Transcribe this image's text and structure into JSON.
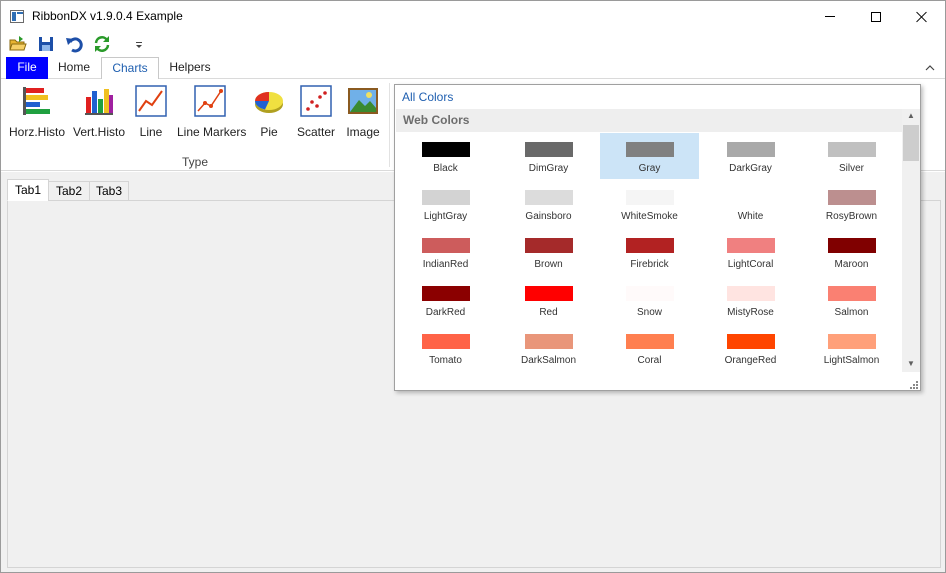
{
  "window": {
    "title": "RibbonDX v1.9.0.4 Example"
  },
  "quick_access": {
    "icons": [
      "open-folder-icon",
      "save-icon",
      "undo-icon",
      "refresh-icon",
      "customize-dropdown-icon"
    ]
  },
  "ribbon_tabs": [
    {
      "label": "File"
    },
    {
      "label": "Home"
    },
    {
      "label": "Charts"
    },
    {
      "label": "Helpers"
    }
  ],
  "chart_buttons": [
    {
      "label": "Horz.Histo",
      "icon": "horizontal-histogram-icon"
    },
    {
      "label": "Vert.Histo",
      "icon": "vertical-histogram-icon"
    },
    {
      "label": "Line",
      "icon": "line-chart-icon"
    },
    {
      "label": "Line Markers",
      "icon": "line-markers-chart-icon"
    },
    {
      "label": "Pie",
      "icon": "pie-chart-icon"
    },
    {
      "label": "Scatter",
      "icon": "scatter-chart-icon"
    },
    {
      "label": "Image",
      "icon": "image-icon"
    }
  ],
  "group_label": "Type",
  "doc_tabs": [
    {
      "label": "Tab1"
    },
    {
      "label": "Tab2"
    },
    {
      "label": "Tab3"
    }
  ],
  "color_popup": {
    "all_colors_label": "All Colors",
    "section_title": "Web Colors",
    "selected": "Gray",
    "colors": [
      {
        "name": "Black",
        "hex": "#000000"
      },
      {
        "name": "DimGray",
        "hex": "#696969"
      },
      {
        "name": "Gray",
        "hex": "#808080"
      },
      {
        "name": "DarkGray",
        "hex": "#A9A9A9"
      },
      {
        "name": "Silver",
        "hex": "#C0C0C0"
      },
      {
        "name": "LightGray",
        "hex": "#D3D3D3"
      },
      {
        "name": "Gainsboro",
        "hex": "#DCDCDC"
      },
      {
        "name": "WhiteSmoke",
        "hex": "#F5F5F5"
      },
      {
        "name": "White",
        "hex": "#FFFFFF"
      },
      {
        "name": "RosyBrown",
        "hex": "#BC8F8F"
      },
      {
        "name": "IndianRed",
        "hex": "#CD5C5C"
      },
      {
        "name": "Brown",
        "hex": "#A52A2A"
      },
      {
        "name": "Firebrick",
        "hex": "#B22222"
      },
      {
        "name": "LightCoral",
        "hex": "#F08080"
      },
      {
        "name": "Maroon",
        "hex": "#800000"
      },
      {
        "name": "DarkRed",
        "hex": "#8B0000"
      },
      {
        "name": "Red",
        "hex": "#FF0000"
      },
      {
        "name": "Snow",
        "hex": "#FFFAFA"
      },
      {
        "name": "MistyRose",
        "hex": "#FFE4E1"
      },
      {
        "name": "Salmon",
        "hex": "#FA8072"
      },
      {
        "name": "Tomato",
        "hex": "#FF6347"
      },
      {
        "name": "DarkSalmon",
        "hex": "#E9967A"
      },
      {
        "name": "Coral",
        "hex": "#FF7F50"
      },
      {
        "name": "OrangeRed",
        "hex": "#FF4500"
      },
      {
        "name": "LightSalmon",
        "hex": "#FFA07A"
      }
    ]
  },
  "colors": {
    "file_tab": "#0000FF",
    "accent_text": "#1F5FB0",
    "selection": "#CCE4F7"
  }
}
